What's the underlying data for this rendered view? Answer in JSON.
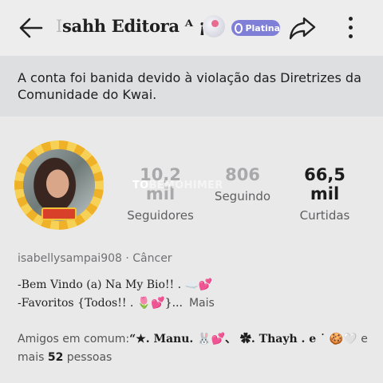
{
  "header": {
    "title_prefix": "I",
    "title": "sahh Editora ᴬ ¡! .",
    "badge": "Platina"
  },
  "notice": "A conta foi banida devido à violação das Diretrizes da Comunidade do Kwai.",
  "stats": {
    "followers_value": "10,2 mil",
    "followers_label": "Seguidores",
    "following_value": "806",
    "following_label": "Seguindo",
    "likes_value": "66,5 mil",
    "likes_label": "Curtidas"
  },
  "watermark": {
    "bright": "TO",
    "faint": "BEMOHIMER"
  },
  "profile": {
    "username_line": "isabellysampai908 · Câncer",
    "bio_line_1": "-Bem Vindo (a) Na My Bio!! . ☁️💕",
    "bio_line_2": "-Favoritos {Todos!! . 🌷💕}...",
    "more_label": "Mais"
  },
  "friends": {
    "prefix": "Amigos em comum:",
    "names": "“★. Manu. 🐰💕、 ✿. Thayh . e ˙ 🍪🤍",
    "joiner": "e mais",
    "count": "52",
    "suffix": "pessoas"
  },
  "colors": {
    "badge": "#7f7fd8",
    "avatar_ring": "#efb127",
    "notice_bg": "#dedfe1"
  },
  "icons": [
    "back-arrow-icon",
    "share-icon",
    "more-vertical-icon",
    "platinum-gem-icon"
  ]
}
